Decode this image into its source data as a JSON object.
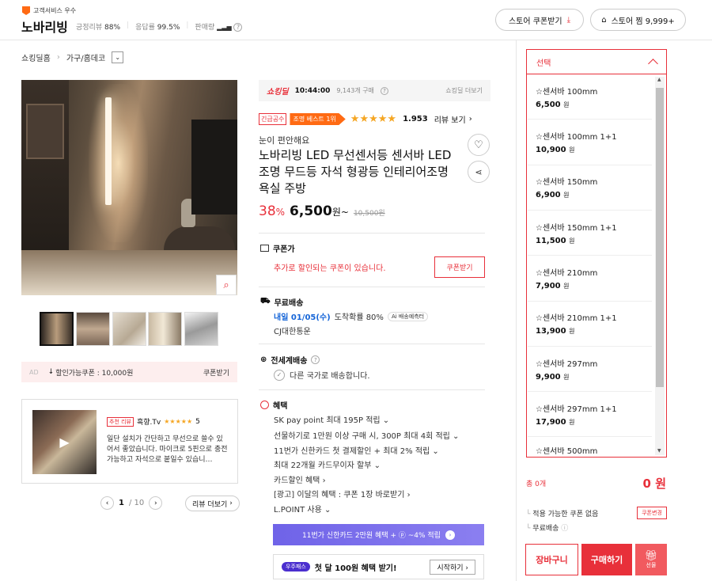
{
  "header": {
    "badge": "고객서비스 우수",
    "store_name": "노바리빙",
    "stats": [
      {
        "label": "긍정리뷰",
        "value": "88%"
      },
      {
        "label": "응답률",
        "value": "99.5%"
      },
      {
        "label": "판매량",
        "value": ""
      }
    ],
    "coupon_button": "스토어 쿠폰받기",
    "store_fav_button": "스토어 찜 9,999+"
  },
  "breadcrumb": {
    "home": "쇼킹딜홈",
    "category": "가구/홈데코"
  },
  "gallery": {
    "thumb_count": 5
  },
  "coupon_banner": {
    "ad": "AD",
    "text": "할인가능쿠폰 : 10,000원",
    "button": "쿠폰받기"
  },
  "review_card": {
    "tag": "추천 리뷰",
    "author": "흑향.Tv",
    "stars": "★★★★★",
    "score": "5",
    "text": "일단 설치가 간단하고 무선으로 쓸수 있어서 좋았습니다. 마이크로 5핀으로 충전 가능하고 자석으로 붙일수 있습니…"
  },
  "pager": {
    "current": "1",
    "total": "/ 10",
    "more": "리뷰 더보기"
  },
  "shocking": {
    "logo": "쇼킹딜",
    "time": "10:44:00",
    "count": "9,143개 구매",
    "more": "쇼킹딜 더보기"
  },
  "product": {
    "tag_urgent": "긴급공수",
    "tag_best": "조명 베스트 1위",
    "stars": "★★★★★",
    "rating": "1.953",
    "review_link": "리뷰 보기",
    "subtitle": "눈이 편안해요",
    "title": "노바리빙 LED 무선센서등 센서바 LED 조명 무드등 자석 형광등 인테리어조명 욕실 주방",
    "discount": "38",
    "discount_unit": "%",
    "price": "6,500",
    "price_unit": "원~",
    "original": "10,500원"
  },
  "coupon_price": {
    "label": "쿠폰가",
    "text": "추가로 할인되는 쿠폰이 있습니다.",
    "button": "쿠폰받기"
  },
  "shipping": {
    "label": "무료배송",
    "date": "내일 01/05(수)",
    "arrival": "도착확률 80%",
    "ai": "Ai 배송예측터",
    "carrier": "CJ대한통운"
  },
  "global": {
    "label": "전세계배송",
    "text": "다른 국가로 배송합니다."
  },
  "benefits": {
    "label": "혜택",
    "items": [
      "SK pay point 최대 195P 적립",
      "선물하기로 1만원 이상 구매 시, 300P 최대 4회 적립",
      "11번가 신한카드 첫 결제할인 + 최대 2% 적립",
      "최대 22개월 카드무이자 할부",
      "카드할인 혜택",
      "[광고] 이달의 혜택 : 쿠폰 1장 바로받기",
      "L.POINT 사용"
    ]
  },
  "card_banner": {
    "text": "11번가 신한카드 2만원 혜택 + ⓟ ~4% 적립"
  },
  "uju_banner": {
    "logo": "우주패스",
    "text": "첫 달 100원 혜택 받기!",
    "button": "시작하기"
  },
  "options": {
    "header": "선택",
    "items": [
      {
        "name": "☆센서바 100mm",
        "price": "6,500",
        "unit": "원"
      },
      {
        "name": "☆센서바 100mm 1+1",
        "price": "10,900",
        "unit": "원"
      },
      {
        "name": "☆센서바 150mm",
        "price": "6,900",
        "unit": "원"
      },
      {
        "name": "☆센서바 150mm 1+1",
        "price": "11,500",
        "unit": "원"
      },
      {
        "name": "☆센서바 210mm",
        "price": "7,900",
        "unit": "원"
      },
      {
        "name": "☆센서바 210mm 1+1",
        "price": "13,900",
        "unit": "원"
      },
      {
        "name": "☆센서바 297mm",
        "price": "9,900",
        "unit": "원"
      },
      {
        "name": "☆센서바 297mm 1+1",
        "price": "17,900",
        "unit": "원"
      },
      {
        "name": "☆센서바 500mm",
        "price": "",
        "unit": ""
      }
    ]
  },
  "summary": {
    "count": "총 0개",
    "total": "0 원",
    "no_coupon": "적용 가능한 쿠폰 없음",
    "coupon_change": "쿠폰변경",
    "free_ship": "무료배송",
    "cart": "장바구니",
    "buy": "구매하기",
    "gift": "선물"
  },
  "colors": {
    "accent": "#e8303a",
    "orange": "#ff6a13",
    "blue": "#1565d8",
    "purple": "#6f63e8"
  }
}
